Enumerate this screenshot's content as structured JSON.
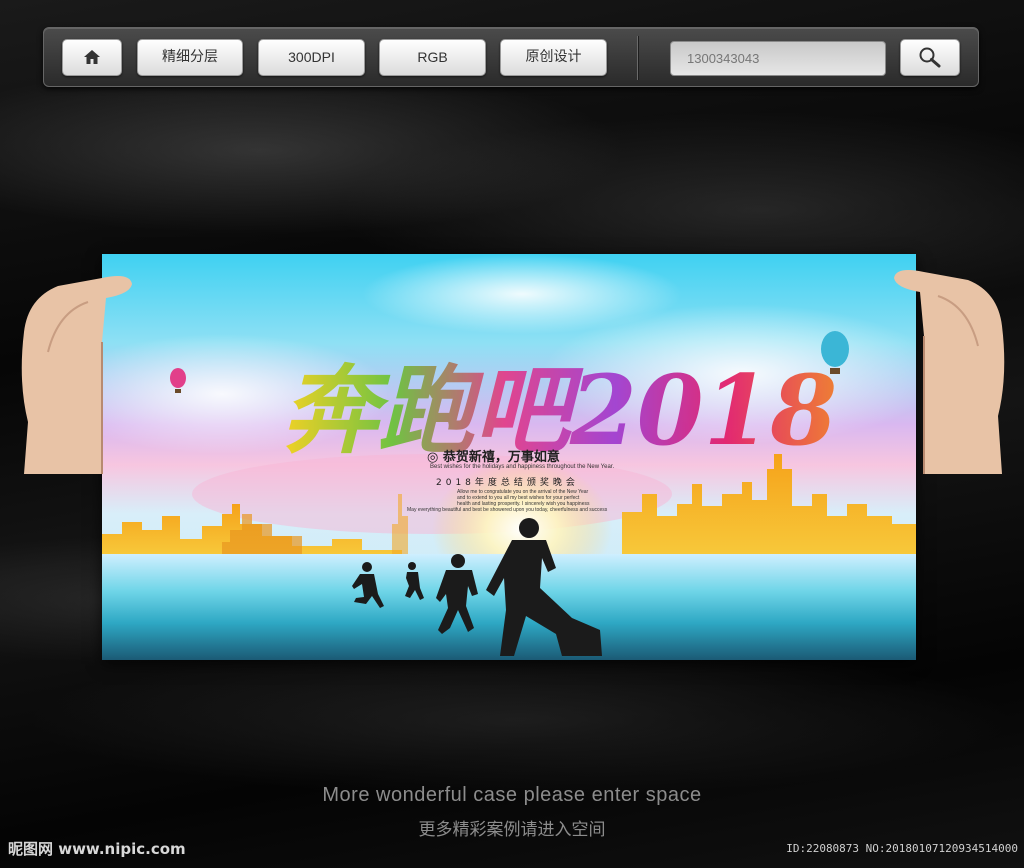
{
  "toolbar": {
    "home_icon": "home-icon",
    "buttons": [
      "精细分层",
      "300DPI",
      "RGB",
      "原创设计"
    ],
    "search_value": "1300343043",
    "search_icon": "magnifier-icon"
  },
  "poster": {
    "headline": "奔跑吧2018",
    "greeting": "◎ 恭贺新禧，万事如意",
    "greeting_en": "Best wishes for the holidays and happiness throughout the New Year.",
    "event_line": "2018年度总结颁奖晚会",
    "small_lines": [
      "Allow me to congratulate you on the arrival of the New Year",
      "and to extend to you all my best wishes for your perfect",
      "health and lasting prosperity. I sincerely wish you happiness",
      "May everything beautiful and best be showered upon you today, cheerfulness and success"
    ],
    "colors": {
      "accent_orange": "#f7a21a",
      "accent_magenta": "#e0287a",
      "sky": "#3fd1f2"
    }
  },
  "tagline_en": "More wonderful case please enter space",
  "tagline_cn": "更多精彩案例请进入空间",
  "footer": {
    "brand": "昵图网 www.nipic.com",
    "id_text": "ID:22080873 NO:20180107120934514000"
  }
}
